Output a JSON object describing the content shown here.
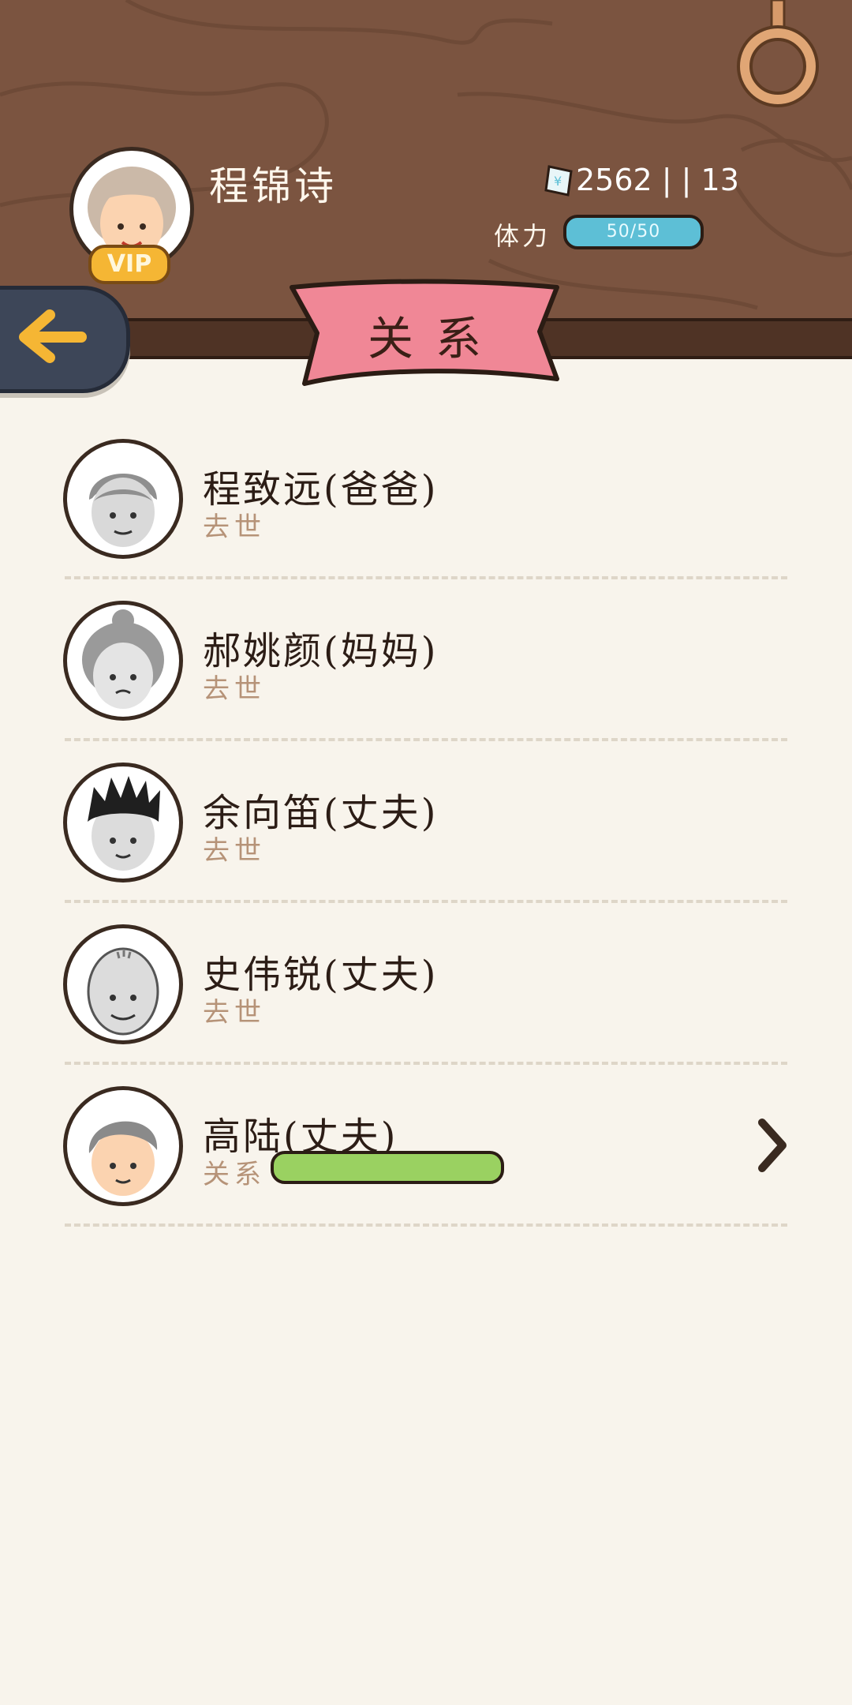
{
  "profile": {
    "name": "程锦诗",
    "vip_label": "VIP",
    "money": "2562 | | 13",
    "stamina_label": "体力",
    "stamina_value": "50/50",
    "stamina_fraction": 1.0
  },
  "page_title": "关系",
  "relations": [
    {
      "name": "程致远(爸爸)",
      "status": "去世",
      "avatar": "old-man-icon"
    },
    {
      "name": "郝姚颜(妈妈)",
      "status": "去世",
      "avatar": "old-woman-bun-icon"
    },
    {
      "name": "余向笛(丈夫)",
      "status": "去世",
      "avatar": "spiky-hair-man-icon"
    },
    {
      "name": "史伟锐(丈夫)",
      "status": "去世",
      "avatar": "bald-old-man-icon"
    },
    {
      "name": "高陆(丈夫)",
      "status": "关系",
      "avatar": "grey-hair-man-icon",
      "relationship_fraction": 1.0
    }
  ],
  "colors": {
    "header_wood": "#7b5440",
    "banner_pink": "#f08796",
    "stamina_blue": "#5dbfd6",
    "relationship_green": "#9ad161",
    "background": "#f8f4ec"
  },
  "icons": {
    "back": "back-arrow-icon",
    "money": "money-note-icon",
    "ring": "hanging-ring-icon",
    "more": "chevron-right-icon"
  }
}
